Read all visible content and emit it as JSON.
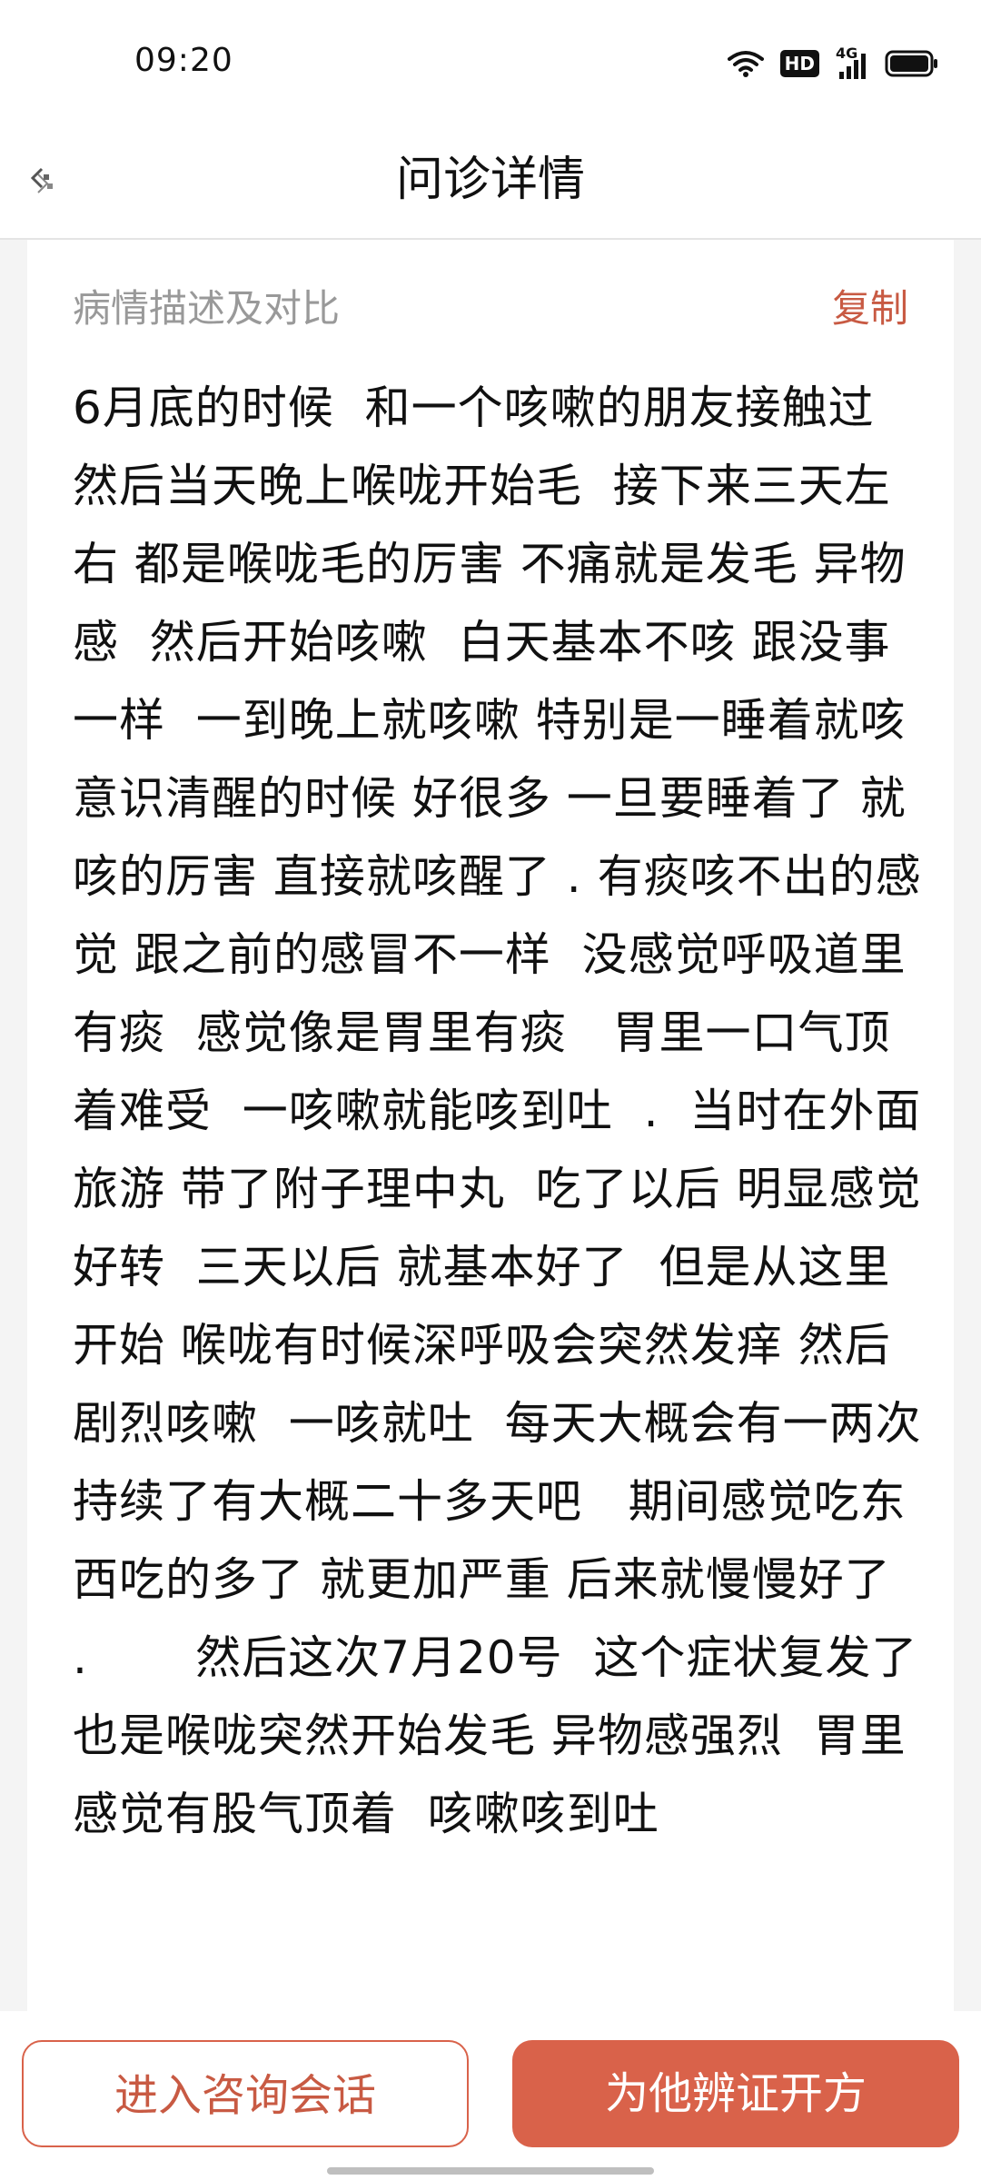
{
  "status_bar": {
    "time": "09:20",
    "hd_label": "HD",
    "network_label": "4G"
  },
  "nav": {
    "title": "问诊详情"
  },
  "card": {
    "section_label": "病情描述及对比",
    "copy_label": "复制",
    "description": "6月底的时候  和一个咳嗽的朋友接触过  然后当天晚上喉咙开始毛  接下来三天左右 都是喉咙毛的厉害 不痛就是发毛 异物感  然后开始咳嗽  白天基本不咳 跟没事一样  一到晚上就咳嗽 特别是一睡着就咳 意识清醒的时候 好很多 一旦要睡着了 就咳的厉害 直接就咳醒了 . 有痰咳不出的感觉 跟之前的感冒不一样  没感觉呼吸道里有痰  感觉像是胃里有痰   胃里一口气顶着难受  一咳嗽就能咳到吐  .  当时在外面旅游 带了附子理中丸  吃了以后 明显感觉 好转  三天以后 就基本好了  但是从这里开始 喉咙有时候深呼吸会突然发痒 然后剧烈咳嗽  一咳就吐  每天大概会有一两次 持续了有大概二十多天吧   期间感觉吃东西吃的多了 就更加严重 后来就慢慢好了      .       然后这次7月20号  这个症状复发了  也是喉咙突然开始发毛 异物感强烈  胃里感觉有股气顶着  咳嗽咳到吐"
  },
  "actions": {
    "consult_label": "进入咨询会话",
    "prescribe_label": "为他辨证开方"
  },
  "colors": {
    "accent": "#d9624a",
    "accent_text": "#c85a43",
    "muted_text": "#999999"
  }
}
